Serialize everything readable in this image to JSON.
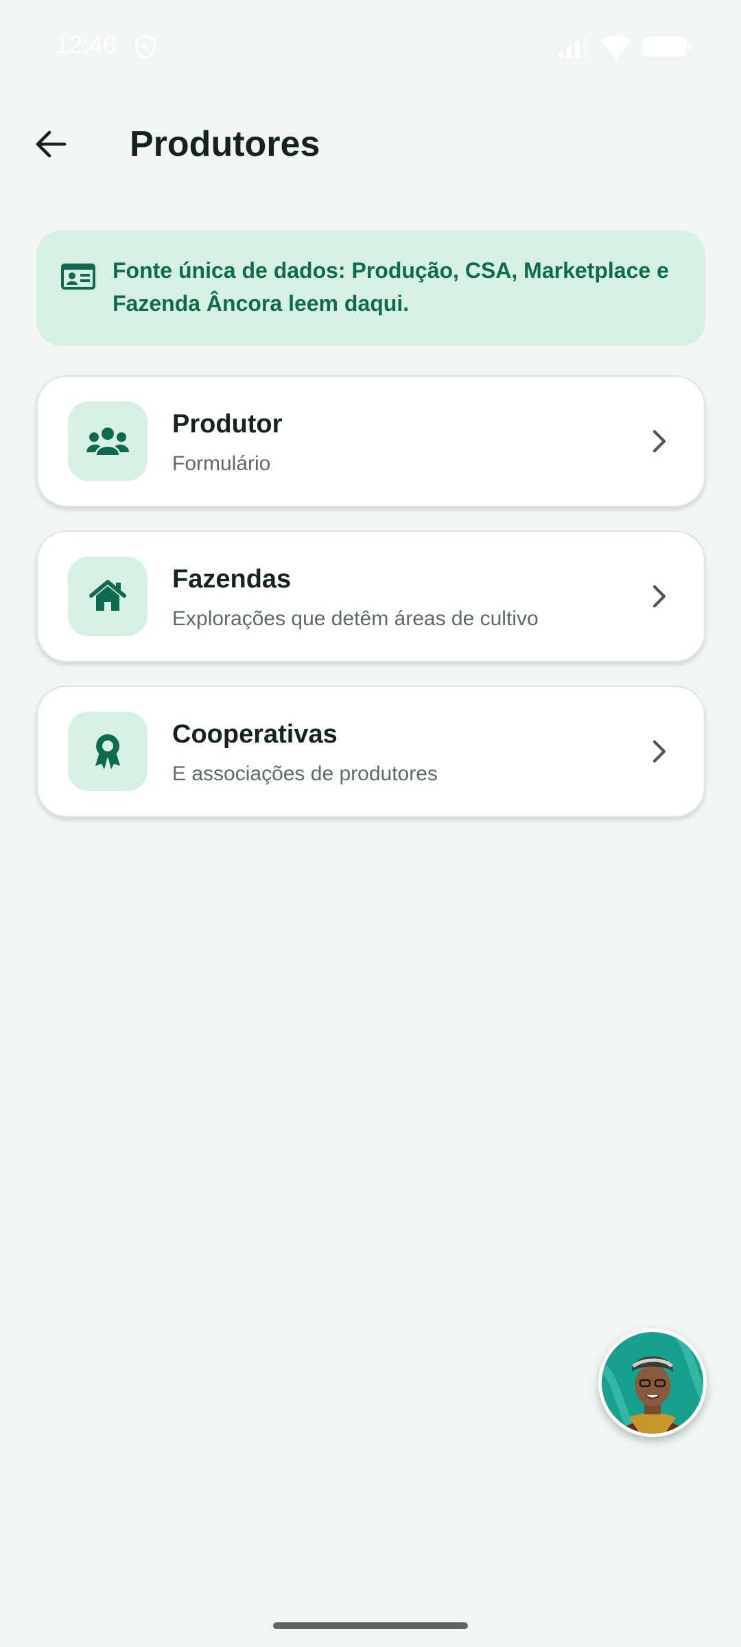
{
  "status_bar": {
    "time": "12:46"
  },
  "header": {
    "title": "Produtores",
    "back_icon": "arrow-left-icon"
  },
  "info_banner": {
    "icon": "id-card-icon",
    "text": "Fonte única de dados: Produção, CSA, Marketplace e Fazenda Âncora leem daqui."
  },
  "menu_items": [
    {
      "title": "Produtor",
      "subtitle": "Formulário",
      "icon": "people-group-icon"
    },
    {
      "title": "Fazendas",
      "subtitle": "Explorações que detêm áreas de cultivo",
      "icon": "house-icon"
    },
    {
      "title": "Cooperativas",
      "subtitle": "E associações de produtores",
      "icon": "award-ribbon-icon"
    }
  ],
  "assistant": {
    "icon": "assistant-avatar"
  },
  "colors": {
    "background": "#f1f6f2",
    "accent": "#0f6a4f",
    "accent_light": "#d6f0e3",
    "card": "#ffffff",
    "text_primary": "#15231d",
    "text_secondary": "#5a6c64"
  }
}
